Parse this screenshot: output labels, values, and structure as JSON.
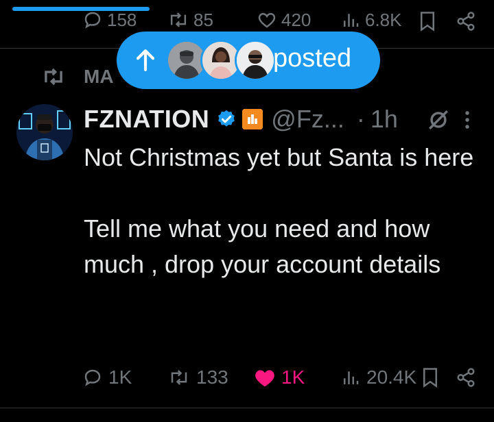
{
  "previous_tweet": {
    "replies": "158",
    "reposts": "85",
    "likes": "420",
    "views": "6.8K"
  },
  "repost_header": {
    "label": "MA"
  },
  "posted_pill": {
    "label": "posted"
  },
  "tweet": {
    "author_name": "FZNATION",
    "handle": "@Fz...",
    "separator": "·",
    "time": "1h",
    "body": "Not Christmas yet but Santa is here\n\nTell me what you need and how much , drop your account details",
    "replies": "1K",
    "reposts": "133",
    "likes": "1K",
    "views": "20.4K"
  },
  "colors": {
    "accent": "#1d9bf0",
    "like": "#f91880",
    "muted": "#71767b",
    "text": "#e7e9ea",
    "background": "#000000"
  },
  "icons": [
    "arrow-up-icon",
    "reply-icon",
    "repost-icon",
    "heart-icon",
    "views-icon",
    "bookmark-icon",
    "share-icon",
    "verified-icon",
    "affiliate-icon",
    "grok-icon",
    "more-icon"
  ]
}
